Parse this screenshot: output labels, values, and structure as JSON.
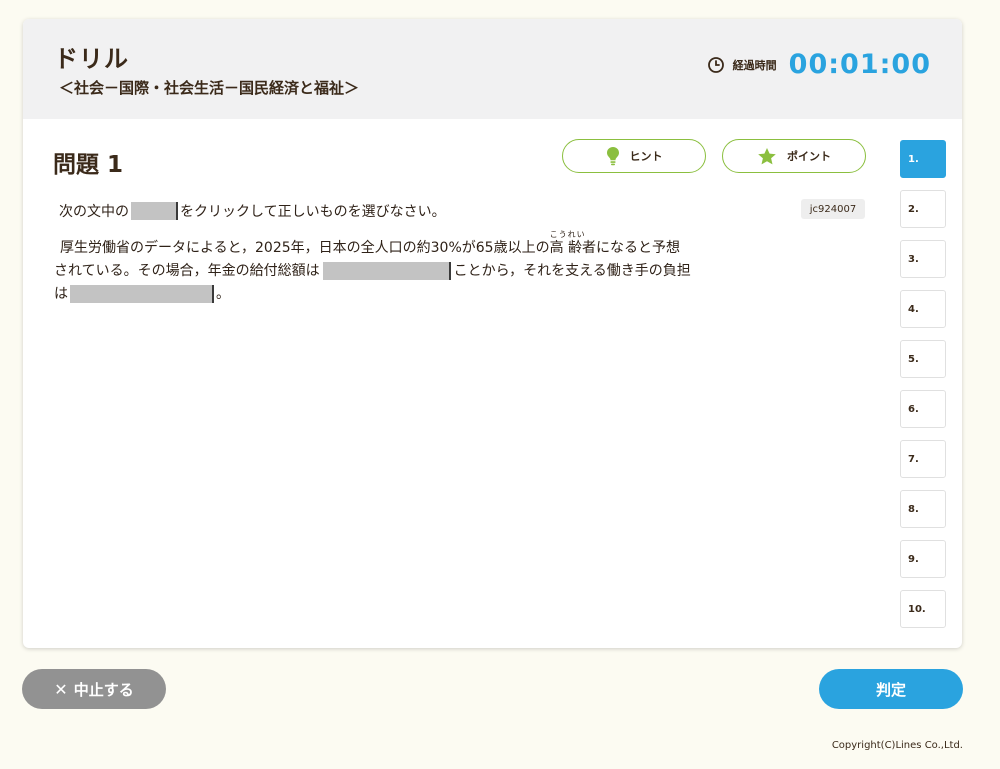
{
  "header": {
    "title": "ドリル",
    "subtitle": "＜社会－国際・社会生活－国民経済と福祉＞",
    "timer_icon": "clock-icon",
    "timer_label": "経過時間",
    "timer_value": "00:01:00"
  },
  "question": {
    "title": "問題 1",
    "hint_label": "ヒント",
    "point_label": "ポイント",
    "code": "jc924007",
    "instruction_before": "次の文中の",
    "instruction_after": "をクリックして正しいものを選びなさい。",
    "passage": {
      "line1_a": "厚生労働省のデータによると，2025年，日本の全人口の約30%が65歳以上の",
      "ruby_base": "高 齢",
      "ruby_text": "こうれい",
      "line1_b": "者になると予想",
      "line2_a": "されている。その場合，年金の給付総額は",
      "line2_b": "ことから，それを支える働き手の負担",
      "line3_a": "は",
      "line3_b": "。"
    }
  },
  "nav": {
    "items": [
      "1.",
      "2.",
      "3.",
      "4.",
      "5.",
      "6.",
      "7.",
      "8.",
      "9.",
      "10."
    ],
    "active_index": 0
  },
  "footer": {
    "quit_icon": "close-icon",
    "quit_label": "中止する",
    "judge_label": "判定",
    "copyright": "Copyright(C)Lines Co.,Ltd."
  },
  "colors": {
    "accent_blue": "#2aa3df",
    "pill_border_green": "#8bbf3f",
    "text_brown": "#3b2a1a",
    "quit_gray": "#929292",
    "page_bg": "#fcfbf2"
  }
}
